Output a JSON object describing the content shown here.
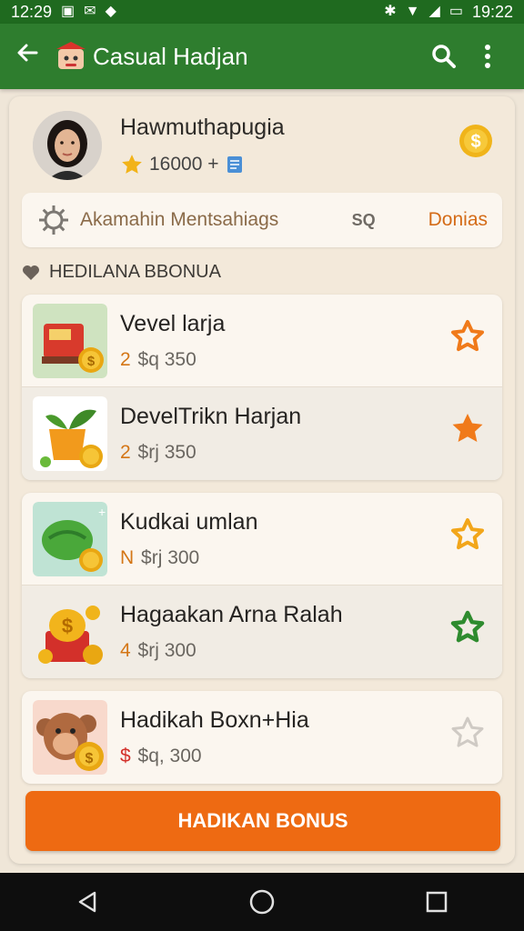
{
  "status_bar": {
    "time": "12:29",
    "clock": "19:22"
  },
  "app_bar": {
    "title": "Casual Hadjan"
  },
  "profile": {
    "name": "Hawmuthapugia",
    "points": "16000 +"
  },
  "filter": {
    "label": "Akamahin Mentsahiags",
    "search_text": "SQ",
    "action": "Donias"
  },
  "section": {
    "title": "HEDILANA BBONUA"
  },
  "groups": [
    {
      "items": [
        {
          "name": "Vevel larja",
          "prefix": "2",
          "value": "$q 350",
          "star": "outline-orange"
        },
        {
          "name": "DevelTrikn Harjan",
          "prefix": "2",
          "value": "$rj 350",
          "star": "filled-orange"
        }
      ]
    },
    {
      "items": [
        {
          "name": "Kudkai umlan",
          "prefix": "N",
          "value": "$rj 300",
          "star": "outline-orange"
        },
        {
          "name": "Hagaakan Arna Ralah",
          "prefix": "4",
          "value": "$rj 300",
          "star": "outline-green"
        }
      ]
    },
    {
      "items": [
        {
          "name": "Hadikah Boxn+Hia",
          "prefix": "$",
          "value": "$q, 300",
          "star": "outline-grey"
        }
      ]
    }
  ],
  "cta": {
    "label": "HADIKAN BONUS"
  },
  "colors": {
    "app_bar": "#2e7d2e",
    "accent": "#ee6a12",
    "star_orange": "#f07a1a",
    "star_green": "#2e8b2e"
  },
  "icons": [
    "back-arrow-icon",
    "search-icon",
    "more-vert-icon",
    "gear-icon",
    "heart-icon",
    "star-icon",
    "coin-icon",
    "back-icon",
    "home-icon",
    "recents-icon"
  ]
}
